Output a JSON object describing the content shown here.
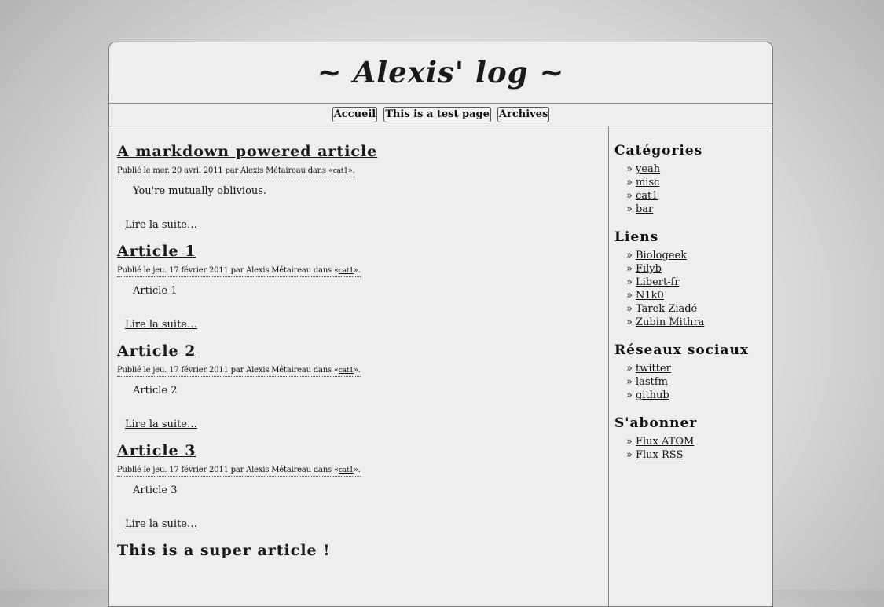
{
  "site": {
    "title": "~ Alexis' log ~"
  },
  "nav": {
    "items": [
      "Accueil",
      "This is a test page",
      "Archives"
    ]
  },
  "articles": [
    {
      "title": "A markdown powered article",
      "meta_prefix": "Publié le mer. 20 avril 2011 par Alexis Métaireau dans «",
      "category": "cat1",
      "meta_suffix": "».",
      "summary": "You're mutually oblivious.",
      "read_more": "Lire la suite…"
    },
    {
      "title": "Article 1",
      "meta_prefix": "Publié le jeu. 17 février 2011 par Alexis Métaireau dans «",
      "category": "cat1",
      "meta_suffix": "».",
      "summary": "Article 1",
      "read_more": "Lire la suite…"
    },
    {
      "title": "Article 2",
      "meta_prefix": "Publié le jeu. 17 février 2011 par Alexis Métaireau dans «",
      "category": "cat1",
      "meta_suffix": "».",
      "summary": "Article 2",
      "read_more": "Lire la suite…"
    },
    {
      "title": "Article 3",
      "meta_prefix": "Publié le jeu. 17 février 2011 par Alexis Métaireau dans «",
      "category": "cat1",
      "meta_suffix": "».",
      "summary": "Article 3",
      "read_more": "Lire la suite…"
    },
    {
      "title": "This is a super article !"
    }
  ],
  "sidebar": {
    "bullet": "»",
    "sections": [
      {
        "title": "Catégories",
        "items": [
          "yeah",
          "misc",
          "cat1",
          "bar"
        ]
      },
      {
        "title": "Liens",
        "items": [
          "Biologeek",
          "Filyb",
          "Libert-fr",
          "N1k0",
          "Tarek Ziadé",
          "Zubin Mithra"
        ]
      },
      {
        "title": "Réseaux sociaux",
        "items": [
          "twitter",
          "lastfm",
          "github"
        ]
      },
      {
        "title": "S'abonner",
        "items": [
          "Flux ATOM",
          "Flux RSS"
        ]
      }
    ]
  }
}
